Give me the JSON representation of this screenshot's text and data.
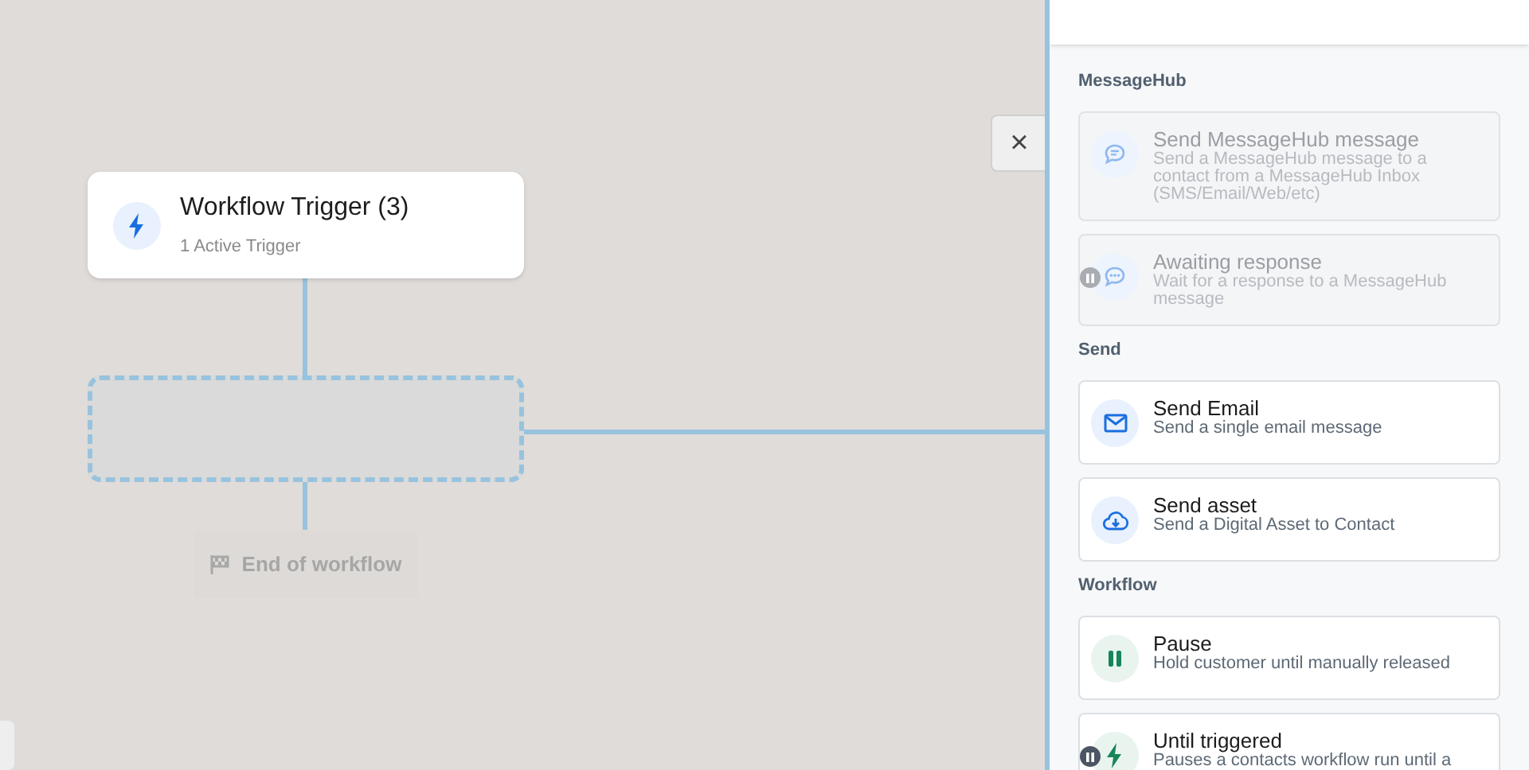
{
  "canvas": {
    "trigger": {
      "title": "Workflow Trigger (3)",
      "subtitle": "1 Active Trigger"
    },
    "end_label": "End of workflow",
    "close_button": "×"
  },
  "panel": {
    "sections": [
      {
        "heading": "MessageHub",
        "items": [
          {
            "kind": "chat",
            "title": "Send MessageHub message",
            "description": "Send a MessageHub message to a contact from a MessageHub Inbox (SMS/Email/Web/etc)",
            "disabled": true,
            "waiting": false
          },
          {
            "kind": "chat-dots",
            "title": "Awaiting response",
            "description": "Wait for a response to a MessageHub message",
            "disabled": true,
            "waiting": true
          }
        ]
      },
      {
        "heading": "Send",
        "items": [
          {
            "kind": "mail",
            "title": "Send Email",
            "description": "Send a single email message",
            "disabled": false,
            "waiting": false
          },
          {
            "kind": "cloud",
            "title": "Send asset",
            "description": "Send a Digital Asset to Contact",
            "disabled": false,
            "waiting": false
          }
        ]
      },
      {
        "heading": "Workflow",
        "items": [
          {
            "kind": "pause",
            "title": "Pause",
            "description": "Hold customer until manually released",
            "disabled": false,
            "waiting": false
          },
          {
            "kind": "bolt",
            "title": "Until triggered",
            "description": "Pauses a contacts workflow run until a",
            "disabled": false,
            "waiting": true
          }
        ]
      }
    ]
  }
}
